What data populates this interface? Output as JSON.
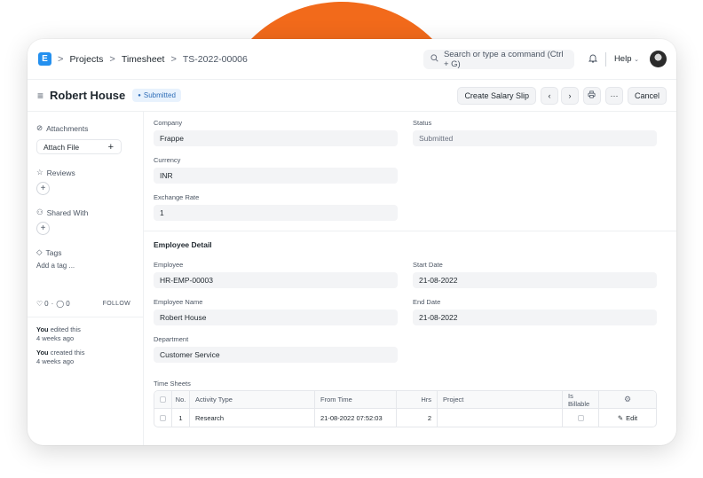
{
  "navbar": {
    "logo_letter": "E",
    "breadcrumbs": [
      "Projects",
      "Timesheet",
      "TS-2022-00006"
    ],
    "separator": ">",
    "search_placeholder": "Search or type a command (Ctrl + G)",
    "help_label": "Help"
  },
  "page_head": {
    "title": "Robert House",
    "status": "Submitted",
    "create_button": "Create Salary Slip",
    "cancel_button": "Cancel",
    "more_label": "···"
  },
  "sidebar": {
    "attachments_label": "Attachments",
    "attach_file_label": "Attach File",
    "reviews_label": "Reviews",
    "shared_with_label": "Shared With",
    "tags_label": "Tags",
    "add_tag_label": "Add a tag ...",
    "likes_count": "0",
    "comments_count": "0",
    "follow_label": "FOLLOW",
    "activity": [
      {
        "actor": "You",
        "action": "edited this",
        "time": "4 weeks ago"
      },
      {
        "actor": "You",
        "action": "created this",
        "time": "4 weeks ago"
      }
    ]
  },
  "form": {
    "company_label": "Company",
    "company_value": "Frappe",
    "status_label": "Status",
    "status_value": "Submitted",
    "currency_label": "Currency",
    "currency_value": "INR",
    "exchange_rate_label": "Exchange Rate",
    "exchange_rate_value": "1",
    "employee_detail_heading": "Employee Detail",
    "employee_label": "Employee",
    "employee_value": "HR-EMP-00003",
    "start_date_label": "Start Date",
    "start_date_value": "21-08-2022",
    "employee_name_label": "Employee Name",
    "employee_name_value": "Robert House",
    "end_date_label": "End Date",
    "end_date_value": "21-08-2022",
    "department_label": "Department",
    "department_value": "Customer Service",
    "time_sheets_label": "Time Sheets"
  },
  "time_sheets": {
    "columns": [
      "No.",
      "Activity Type",
      "From Time",
      "Hrs",
      "Project",
      "Is Billable"
    ],
    "rows": [
      {
        "no": "1",
        "activity": "Research",
        "from_time": "21-08-2022 07:52:03",
        "hrs": "2",
        "project": "",
        "edit_label": "Edit"
      }
    ]
  },
  "colors": {
    "accent_orange": "#f26a1b",
    "logo_blue": "#2490ef",
    "status_pill_bg": "#e8f2fd"
  }
}
